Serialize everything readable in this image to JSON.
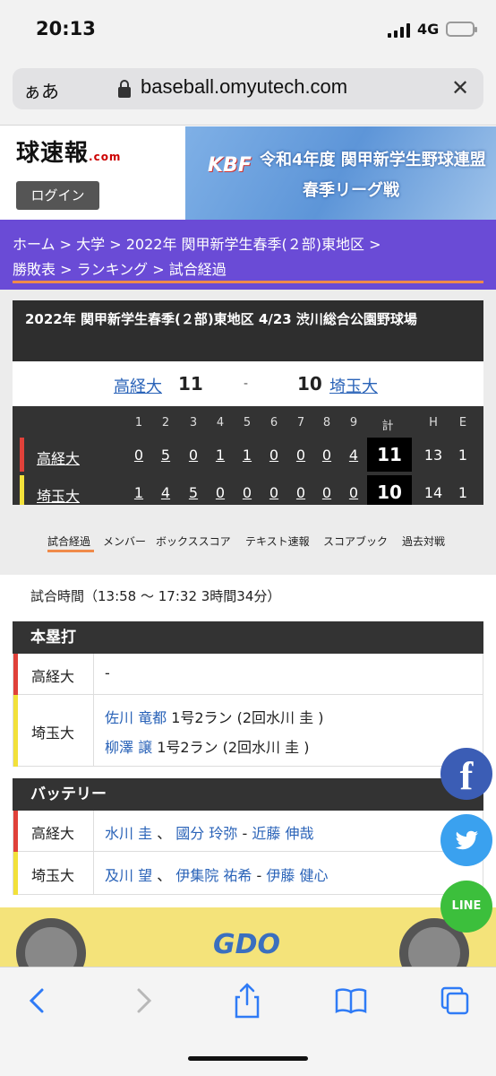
{
  "status_bar": {
    "time": "20:13",
    "network": "4G"
  },
  "browser": {
    "aa_label": "ぁあ",
    "url": "baseball.omyutech.com"
  },
  "header": {
    "logo_text": "球速報",
    "logo_suffix": ".com",
    "login_label": "ログイン",
    "banner_brand": "KBF",
    "banner_title_1": "令和4年度 関甲新学生野球連盟",
    "banner_title_2": "春季リーグ戦"
  },
  "breadcrumb": {
    "home": "ホーム",
    "university": "大学",
    "league": "2022年 関甲新学生春季(２部)東地区",
    "standings": "勝敗表",
    "ranking": "ランキング",
    "current": "試合経過",
    "separator": ">"
  },
  "game": {
    "title": "2022年 関甲新学生春季(２部)東地区 4/23 渋川総合公園野球場",
    "home_team": "高経大",
    "away_team": "埼玉大",
    "home_score": "11",
    "away_score": "10",
    "dash": "-"
  },
  "scoreboard": {
    "innings": [
      "1",
      "2",
      "3",
      "4",
      "5",
      "6",
      "7",
      "8",
      "9"
    ],
    "total_label": "計",
    "h_label": "H",
    "e_label": "E",
    "rows": [
      {
        "team": "高経大",
        "runs": [
          "0",
          "5",
          "0",
          "1",
          "1",
          "0",
          "0",
          "0",
          "4"
        ],
        "total": "11",
        "h": "13",
        "e": "1",
        "color": "#e0413a"
      },
      {
        "team": "埼玉大",
        "runs": [
          "1",
          "4",
          "5",
          "0",
          "0",
          "0",
          "0",
          "0",
          "0"
        ],
        "total": "10",
        "h": "14",
        "e": "1",
        "color": "#f2e13a"
      }
    ]
  },
  "tabs": [
    "試合経過",
    "メンバー",
    "ボックススコア",
    "テキスト速報",
    "スコアブック",
    "過去対戦"
  ],
  "game_time": "試合時間（13:58 〜 17:32 3時間34分）",
  "homeruns": {
    "header": "本塁打",
    "home_team": "高経大",
    "home_value": "-",
    "away_team": "埼玉大",
    "entries": [
      {
        "player": "佐川 竜都",
        "detail": "1号2ラン (2回水川 圭 )"
      },
      {
        "player": "柳澤 譲",
        "detail": "1号2ラン (2回水川 圭 )"
      }
    ]
  },
  "battery": {
    "header": "バッテリー",
    "rows": [
      {
        "team": "高経大",
        "p1": "水川 圭",
        "sep1": "、",
        "p2": "國分 玲弥",
        "dash": "-",
        "c": "近藤 伸哉"
      },
      {
        "team": "埼玉大",
        "p1": "及川 望",
        "sep1": "、",
        "p2": "伊集院 祐希",
        "dash": "-",
        "c": "伊藤 健心"
      }
    ]
  },
  "social": {
    "facebook": "f",
    "twitter": "twitter-bird",
    "line": "LINE"
  },
  "ad": {
    "text": "GDO"
  },
  "colors": {
    "breadcrumb": "#6a4bd6",
    "accent": "#f08a4a",
    "link": "#2a63b8"
  }
}
